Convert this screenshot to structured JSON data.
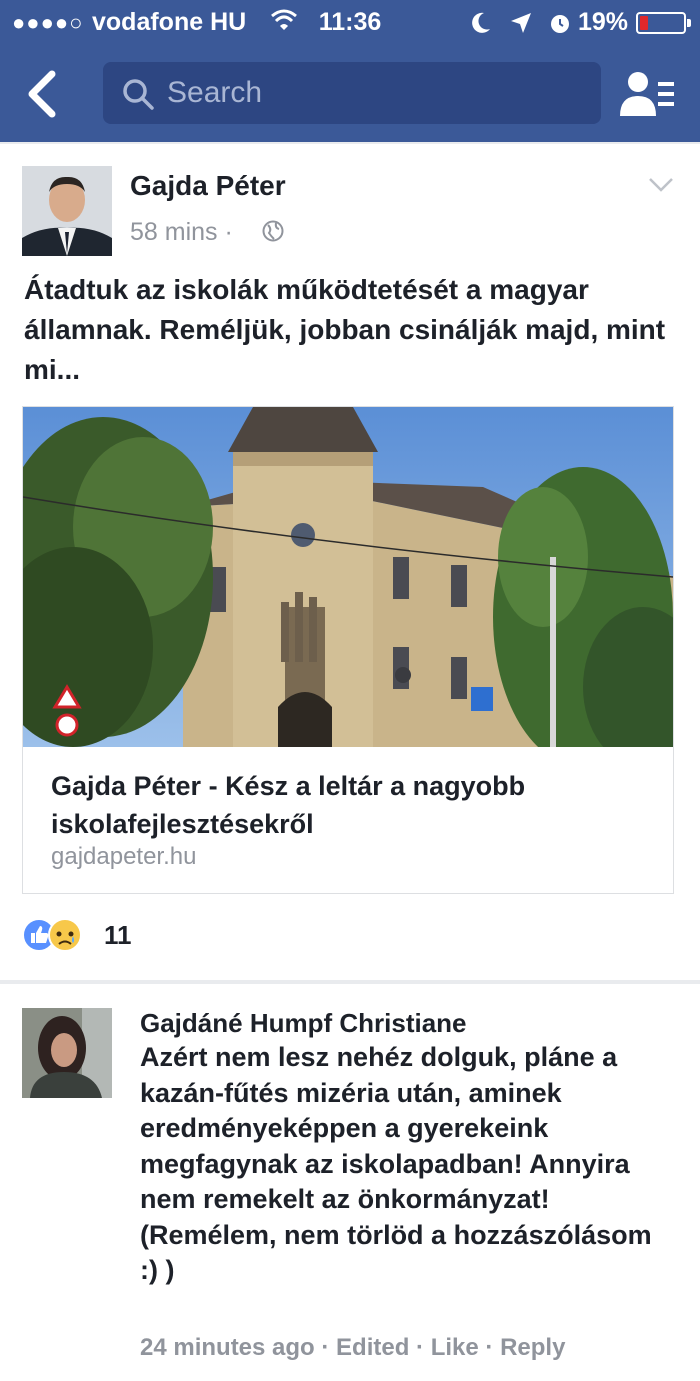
{
  "status_bar": {
    "signal": "●●●●○",
    "carrier": "vodafone HU",
    "time": "11:36",
    "battery_percent": "19%",
    "battery_level": 0.19,
    "battery_color": "#e0282b"
  },
  "nav": {
    "search_placeholder": "Search"
  },
  "post": {
    "author": "Gajda Péter",
    "time": "58 mins · ",
    "text": "Átadtuk az iskolák működtetését a magyar államnak. Reméljük, jobban csinálják majd, mint mi...",
    "link": {
      "title": "Gajda Péter - Kész a leltár a nagyobb iskolafejlesztésekről",
      "domain": "gajdapeter.hu"
    },
    "reactions": {
      "types": [
        "like-icon",
        "sad-icon"
      ],
      "count": "11"
    }
  },
  "comment": {
    "author": "Gajdáné Humpf Christiane",
    "text": "Azért nem lesz nehéz dolguk, pláne a kazán-fűtés mizéria után, aminek eredményeképpen a gyerekeink megfagynak az iskolapadban! Annyira nem remekelt az önkormányzat! (Remélem, nem törlöd a hozzászólásom :) )",
    "time": "24 minutes ago",
    "sep1": " · ",
    "edited": "Edited",
    "sep2": " · ",
    "like": "Like",
    "sep3": " · ",
    "reply": "Reply"
  },
  "colors": {
    "brand": "#3b5998",
    "search_bg": "#2d4682",
    "meta_text": "#90949c"
  }
}
